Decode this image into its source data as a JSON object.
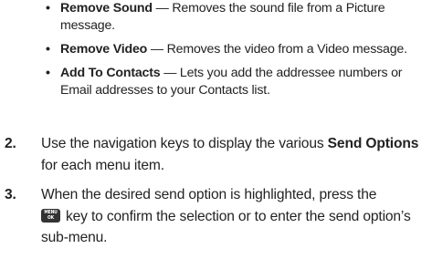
{
  "options": [
    {
      "term": "Remove Sound",
      "desc": " — Removes the sound file from a Picture message."
    },
    {
      "term": "Remove Video",
      "desc": " — Removes the video from a Video message."
    },
    {
      "term": "Add To Contacts",
      "desc": " — Lets you add the addressee numbers or Email addresses to your Contacts list."
    }
  ],
  "steps": [
    {
      "number": "2.",
      "before": "Use the navigation keys to display the various ",
      "bold": "Send Options",
      "after": " for each menu item."
    },
    {
      "number": "3.",
      "before": "When the desired send option is highlighted, press the",
      "key_top": "MENU",
      "key_bottom": "OK",
      "after": "key to confirm the selection or to enter the send option’s sub-menu.",
      "icon": "menu-ok-key-icon"
    }
  ],
  "bullet_char": "•"
}
